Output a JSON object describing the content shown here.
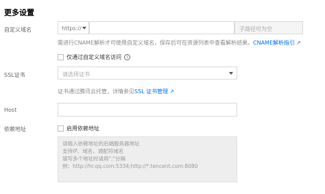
{
  "section": {
    "title": "更多设置"
  },
  "custom_domain": {
    "label": "自定义域名",
    "protocol_value": "https://",
    "domain_placeholder": "",
    "path_placeholder": "子路径可为空",
    "help_text": "需进行CNAME解析才可使用自定义域名，保存后可在资源列表中查看解析结果。",
    "help_link": "CNAME解析指引",
    "only_access_label": "仅通过自定义域名访问"
  },
  "ssl": {
    "label": "SSL证书",
    "select_placeholder": "请选择证书",
    "help_text": "证书通过腾讯云托管，详情参见",
    "help_link": "SSL 证书管理"
  },
  "host": {
    "label": "Host",
    "value": ""
  },
  "dependency": {
    "label": "依赖地址",
    "checkbox_label": "启用依赖地址",
    "textarea_lines": [
      "请输入依赖地址的后端服务器地址",
      "支持IP、域名、通配符域名",
      "填写多个地址时请用\";\"分隔",
      "例：http://hr.qq.com:5334;http://*.tencent.com:8080"
    ]
  },
  "colors": {
    "link": "#006eff",
    "input_disabled_bg": "#eeeeee",
    "text_muted": "#888888"
  },
  "icons": [
    "chevron-down-icon",
    "info-icon",
    "external-link-icon"
  ]
}
